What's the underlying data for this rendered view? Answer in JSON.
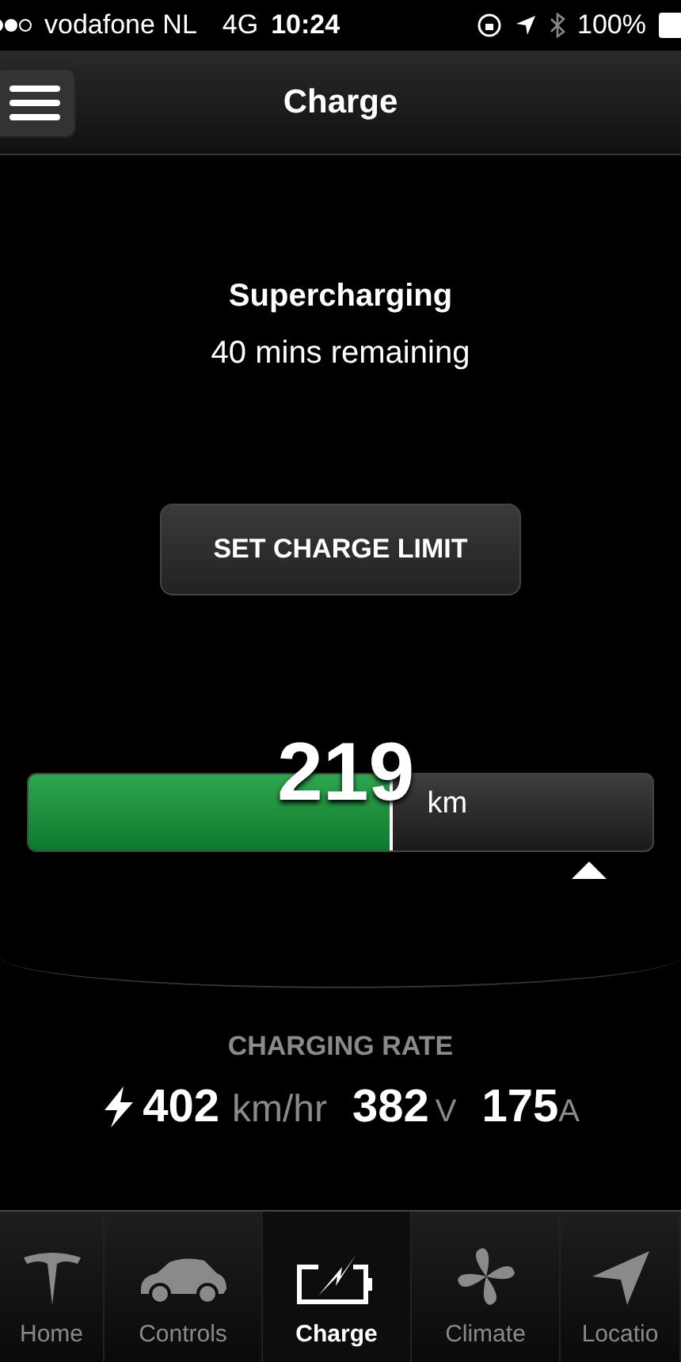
{
  "status_bar": {
    "carrier": "vodafone NL",
    "network": "4G",
    "time": "10:24",
    "battery": "100%"
  },
  "header": {
    "title": "Charge"
  },
  "charge_status": {
    "title": "Supercharging",
    "subtitle": "40 mins remaining"
  },
  "set_limit_button": {
    "label": "SET CHARGE LIMIT"
  },
  "battery": {
    "level": 0.585,
    "range": "219",
    "unit": "km"
  },
  "charging_rate": {
    "label": "CHARGING RATE",
    "speed": "402",
    "speed_unit": "km/hr",
    "voltage": "382",
    "voltage_unit": "V",
    "current": "175",
    "current_unit": "A"
  },
  "tabs": [
    {
      "label": "Home",
      "kind": "logo",
      "selected": false
    },
    {
      "label": "Controls",
      "kind": "car",
      "selected": false
    },
    {
      "label": "Charge",
      "kind": "charge",
      "selected": true
    },
    {
      "label": "Climate",
      "kind": "fan",
      "selected": false
    },
    {
      "label": "Locatio",
      "kind": "location",
      "selected": false
    }
  ]
}
